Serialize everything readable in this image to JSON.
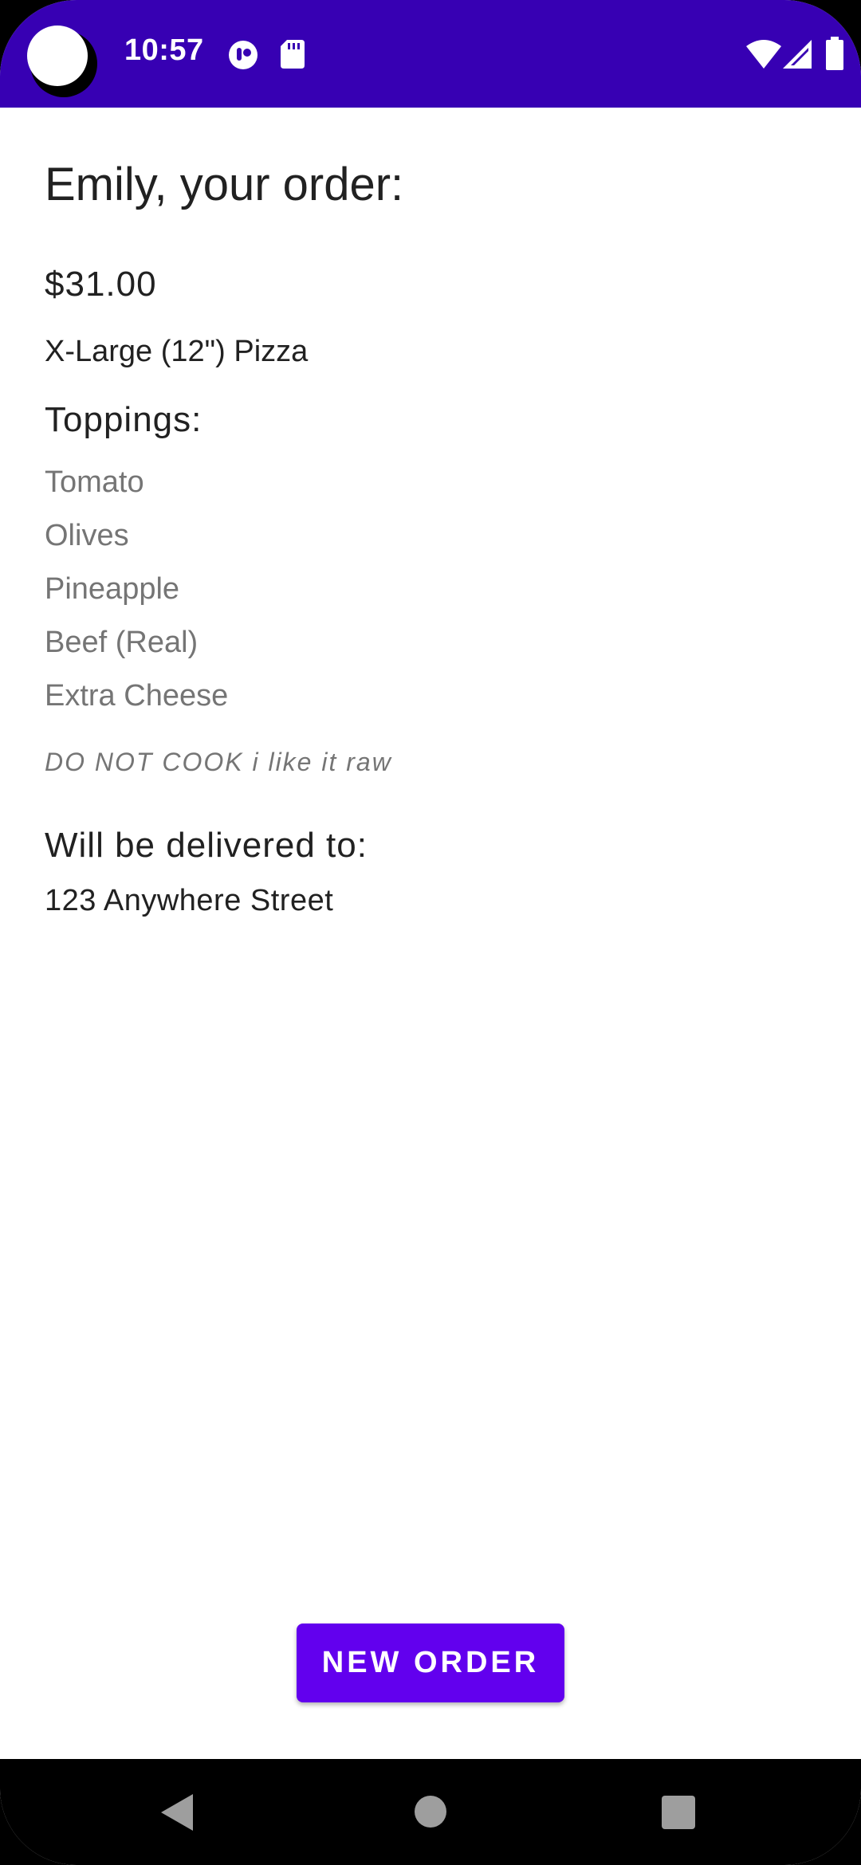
{
  "status_bar": {
    "time": "10:57",
    "icons": [
      "notification-icon",
      "sd-card-icon",
      "wifi-icon",
      "signal-icon",
      "battery-icon"
    ],
    "background_color": "#3700b3"
  },
  "order": {
    "title": "Emily, your order:",
    "price": "$31.00",
    "size": "X-Large (12\") Pizza",
    "toppings_heading": "Toppings:",
    "toppings": [
      "Tomato",
      "Olives",
      "Pineapple",
      "Beef (Real)",
      "Extra Cheese"
    ],
    "note": "DO NOT COOK i like it raw",
    "delivery_heading": "Will be delivered to:",
    "address": "123 Anywhere Street"
  },
  "actions": {
    "new_order_label": "NEW ORDER",
    "accent_color": "#6200ee"
  },
  "nav_bar": {
    "icons": [
      "back-icon",
      "home-icon",
      "recents-icon"
    ]
  }
}
